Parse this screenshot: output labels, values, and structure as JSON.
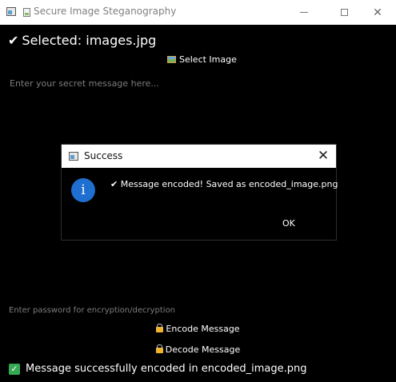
{
  "window": {
    "title": "Secure Image Steganography",
    "controls": {
      "minimize": "—",
      "maximize": "☐",
      "close": "✕"
    }
  },
  "main": {
    "selected_label": "Selected: images.jpg",
    "selected_check": "✔",
    "select_button": "Select Image",
    "message_placeholder": "Enter your secret message here...",
    "password_placeholder": "Enter password for encryption/decryption",
    "encode_button": "Encode Message",
    "decode_button": "Decode Message",
    "status_check": "✓",
    "status_text": "Message successfully encoded in encoded_image.png"
  },
  "dialog": {
    "title": "Success",
    "close": "✕",
    "info_glyph": "i",
    "message": "✔ Message encoded! Saved as encoded_image.png",
    "ok_button": "OK"
  },
  "colors": {
    "background": "#000000",
    "titlebar": "#ffffff",
    "info_blue": "#1e6fd0",
    "status_green": "#34a853",
    "lock_gold": "#f0b32a"
  },
  "icons": [
    "app-icon",
    "image-icon",
    "lock-icon",
    "info-icon",
    "check-icon",
    "close-icon"
  ]
}
